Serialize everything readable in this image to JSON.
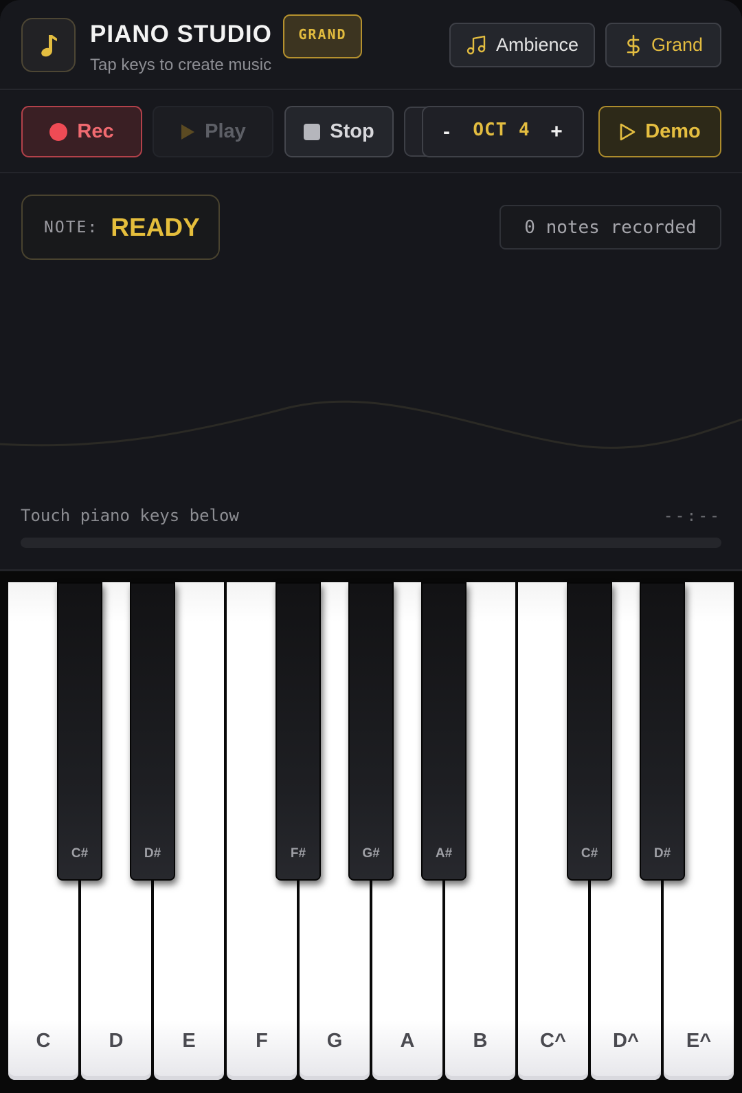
{
  "header": {
    "title": "PIANO STUDIO",
    "subtitle": "Tap keys to create music",
    "badge": "GRAND",
    "logo_icon": "music-note-icon",
    "ambience_label": "Ambience",
    "ambience_icon": "music-notes-icon",
    "grand_label": "Grand",
    "grand_icon": "dollar-icon"
  },
  "controls": {
    "rec_label": "Rec",
    "play_label": "Play",
    "stop_label": "Stop",
    "octave_minus": "-",
    "octave_label": "OCT 4",
    "octave_plus": "+",
    "demo_label": "Demo"
  },
  "display": {
    "note_label": "NOTE:",
    "note_value": "READY",
    "notes_recorded": "0 notes recorded",
    "hint": "Touch piano keys below",
    "time": "--:--",
    "progress": 0
  },
  "piano": {
    "white_keys": [
      "C",
      "D",
      "E",
      "F",
      "G",
      "A",
      "B",
      "C^",
      "D^",
      "E^"
    ],
    "black_keys": [
      {
        "label": "C#",
        "after": 0
      },
      {
        "label": "D#",
        "after": 1
      },
      {
        "label": "F#",
        "after": 3
      },
      {
        "label": "G#",
        "after": 4
      },
      {
        "label": "A#",
        "after": 5
      },
      {
        "label": "C#",
        "after": 7
      },
      {
        "label": "D#",
        "after": 8
      }
    ]
  },
  "colors": {
    "accent_gold": "#e3bd40",
    "record_red": "#f06a70",
    "background": "#16171c"
  }
}
